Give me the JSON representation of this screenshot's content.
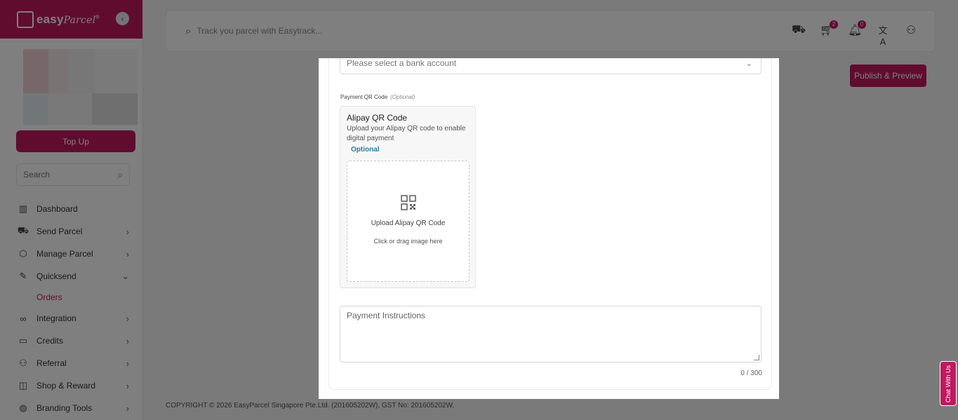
{
  "brand": {
    "name": "easy",
    "name_italic": "Parcel",
    "registered": "®"
  },
  "sidebar": {
    "topup_label": "Top Up",
    "search_placeholder": "Search",
    "items": [
      {
        "label": "Dashboard",
        "icon": "bar-chart-icon",
        "has_chevron": false
      },
      {
        "label": "Send Parcel",
        "icon": "truck-icon",
        "has_chevron": true
      },
      {
        "label": "Manage Parcel",
        "icon": "box-icon",
        "has_chevron": true
      },
      {
        "label": "Quicksend",
        "icon": "document-send-icon",
        "has_chevron": true,
        "expanded": true
      },
      {
        "label": "Integration",
        "icon": "link-icon",
        "has_chevron": true
      },
      {
        "label": "Credits",
        "icon": "wallet-icon",
        "has_chevron": true
      },
      {
        "label": "Referral",
        "icon": "user-plus-icon",
        "has_chevron": true
      },
      {
        "label": "Shop & Reward",
        "icon": "shopping-bag-icon",
        "has_chevron": true
      },
      {
        "label": "Branding Tools",
        "icon": "palette-icon",
        "has_chevron": true
      }
    ],
    "subitem": "Orders"
  },
  "header": {
    "search_placeholder": "Track you parcel with Easytrack...",
    "cart_count": "2",
    "notification_count": "0"
  },
  "publish_label": "Publish & Preview",
  "footer": "COPYRIGHT © 2026 EasyParcel Singapore Pte.Ltd. (201605202W), GST No: 201605202W.",
  "chat_label": "Chat With Us",
  "modal": {
    "bank_select_placeholder": "Please select a bank account",
    "qr_section_label": "Payment QR Code",
    "qr_section_optional": "(Optional)",
    "qr_card": {
      "title": "Alipay QR Code",
      "description": "Upload your Alipay QR code to enable digital payment",
      "badge": "Optional",
      "upload_title": "Upload Alipay QR Code",
      "upload_hint": "Click or drag image here"
    },
    "instructions_placeholder": "Payment Instructions",
    "char_counter": "0 / 300"
  },
  "colors": {
    "brand": "#c0185f",
    "optional_badge": "#2b7fa1"
  }
}
